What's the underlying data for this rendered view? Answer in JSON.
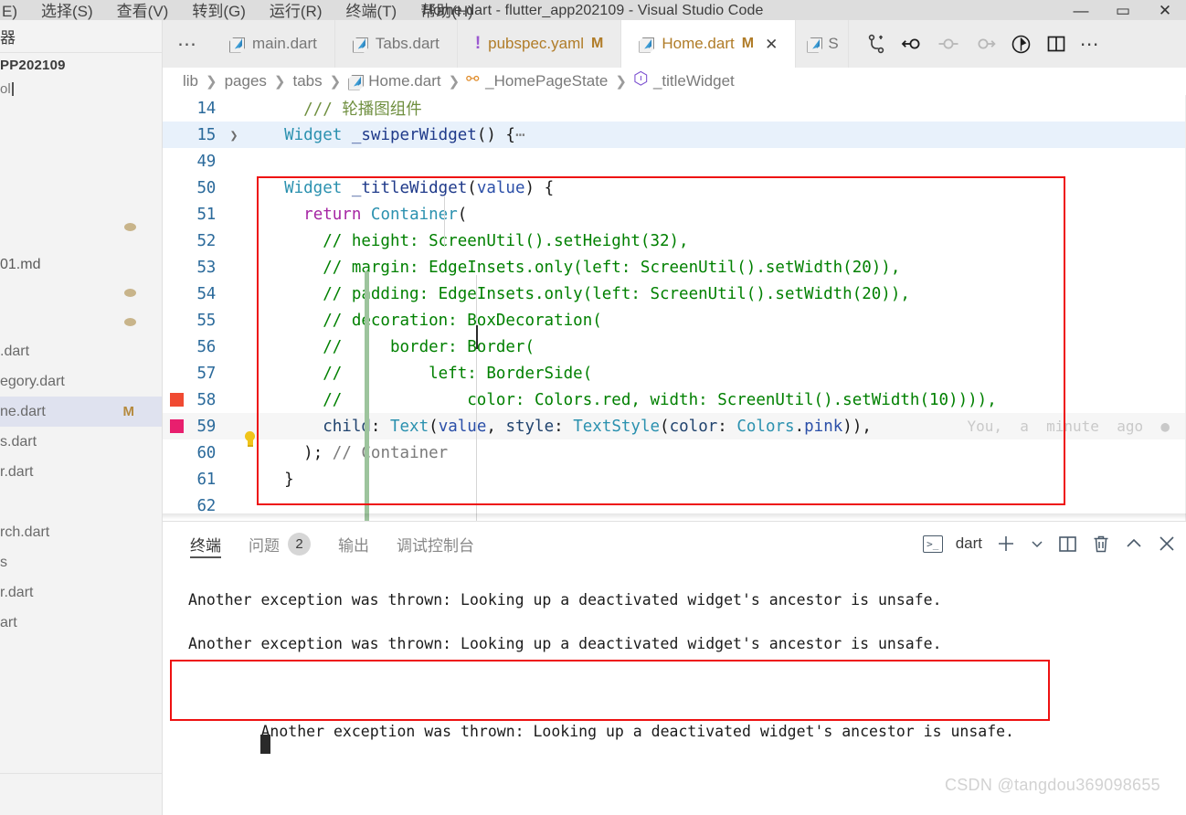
{
  "window": {
    "title": "Home.dart - flutter_app202109 - Visual Studio Code",
    "menu": [
      "E)",
      "选择(S)",
      "查看(V)",
      "转到(G)",
      "运行(R)",
      "终端(T)",
      "帮助(H)"
    ],
    "controls": {
      "minimize": "—",
      "maximize": "▭",
      "close": "✕"
    }
  },
  "sidebar": {
    "title_clipped": "器",
    "folder_clipped": "PP202109",
    "search_clipped": "ol",
    "items": [
      {
        "label": "01.md",
        "kind": "file",
        "badge": "",
        "dot": false
      },
      {
        "label": ".dart",
        "kind": "dart",
        "badge": "",
        "dot": false
      },
      {
        "label": "egory.dart",
        "kind": "dart",
        "badge": "",
        "dot": false
      },
      {
        "label": "ne.dart",
        "kind": "dart",
        "badge": "M",
        "dot": false,
        "selected": true
      },
      {
        "label": "s.dart",
        "kind": "dart",
        "badge": "",
        "dot": false
      },
      {
        "label": "r.dart",
        "kind": "dart",
        "badge": "",
        "dot": false
      },
      {
        "label": "rch.dart",
        "kind": "dart",
        "badge": "",
        "dot": false
      },
      {
        "label": "s",
        "kind": "folder",
        "badge": "",
        "dot": false
      },
      {
        "label": "r.dart",
        "kind": "dart",
        "badge": "",
        "dot": false
      },
      {
        "label": "art",
        "kind": "dart",
        "badge": "",
        "dot": false
      }
    ]
  },
  "tabs": [
    {
      "label": "main.dart",
      "icon": "dart-icon",
      "modified": "",
      "active": false
    },
    {
      "label": "Tabs.dart",
      "icon": "dart-icon",
      "modified": "",
      "active": false
    },
    {
      "label": "pubspec.yaml",
      "icon": "warning-icon",
      "modified": "M",
      "active": false
    },
    {
      "label": "Home.dart",
      "icon": "dart-icon",
      "modified": "M",
      "active": true
    }
  ],
  "tab_overflow_clipped": "S",
  "tab_more_ellipsis": "⋯",
  "breadcrumb": [
    {
      "label": "lib",
      "icon": ""
    },
    {
      "label": "pages",
      "icon": ""
    },
    {
      "label": "tabs",
      "icon": ""
    },
    {
      "label": "Home.dart",
      "icon": "dart-icon"
    },
    {
      "label": "_HomePageState",
      "icon": "class-icon"
    },
    {
      "label": "_titleWidget",
      "icon": "method-cube-icon"
    }
  ],
  "editor": {
    "codelens": "You,  a  minute  ago",
    "lines": [
      {
        "num": "14",
        "folded": false,
        "highlight": false,
        "tokens": [
          {
            "t": "/// ",
            "c": "t-doc"
          },
          {
            "t": "轮播图组件",
            "c": "t-doc"
          }
        ],
        "indent": "    "
      },
      {
        "num": "15",
        "folded": true,
        "highlight": true,
        "tokens": [
          {
            "t": "Widget",
            "c": "t-type"
          },
          {
            "t": " ",
            "c": "t-plain"
          },
          {
            "t": "_swiperWidget",
            "c": "t-fn"
          },
          {
            "t": "() {",
            "c": "t-plain"
          },
          {
            "t": "⋯",
            "c": "t-gray"
          }
        ],
        "indent": "  "
      },
      {
        "num": "49",
        "folded": false,
        "highlight": false,
        "tokens": [],
        "indent": ""
      },
      {
        "num": "50",
        "folded": false,
        "highlight": false,
        "tokens": [
          {
            "t": "Widget",
            "c": "t-type"
          },
          {
            "t": " ",
            "c": "t-plain"
          },
          {
            "t": "_titleWidget",
            "c": "t-fn"
          },
          {
            "t": "(",
            "c": "t-plain"
          },
          {
            "t": "value",
            "c": "t-param"
          },
          {
            "t": ") {",
            "c": "t-plain"
          }
        ],
        "indent": "  "
      },
      {
        "num": "51",
        "folded": false,
        "highlight": false,
        "tokens": [
          {
            "t": "return",
            "c": "t-kw"
          },
          {
            "t": " ",
            "c": "t-plain"
          },
          {
            "t": "Container",
            "c": "t-cls"
          },
          {
            "t": "(",
            "c": "t-plain"
          }
        ],
        "indent": "    "
      },
      {
        "num": "52",
        "folded": false,
        "highlight": false,
        "tokens": [
          {
            "t": "// height: ScreenUtil().setHeight(32),",
            "c": "t-comment"
          }
        ],
        "indent": "      "
      },
      {
        "num": "53",
        "folded": false,
        "highlight": false,
        "tokens": [
          {
            "t": "// margin: EdgeInsets.only(left: ScreenUtil().setWidth(20)),",
            "c": "t-comment"
          }
        ],
        "indent": "      "
      },
      {
        "num": "54",
        "folded": false,
        "highlight": false,
        "tokens": [
          {
            "t": "// padding: EdgeInsets.only(left: ScreenUtil().setWidth(20)),",
            "c": "t-comment"
          }
        ],
        "indent": "      "
      },
      {
        "num": "55",
        "folded": false,
        "highlight": false,
        "tokens": [
          {
            "t": "// decoration: BoxDecoration(",
            "c": "t-comment"
          }
        ],
        "indent": "      "
      },
      {
        "num": "56",
        "folded": false,
        "highlight": false,
        "tokens": [
          {
            "t": "//     border: Border(",
            "c": "t-comment"
          }
        ],
        "indent": "      "
      },
      {
        "num": "57",
        "folded": false,
        "highlight": false,
        "tokens": [
          {
            "t": "//         left: BorderSide(",
            "c": "t-comment"
          }
        ],
        "indent": "      "
      },
      {
        "num": "58",
        "folded": false,
        "highlight": false,
        "breakpoint": "red",
        "tokens": [
          {
            "t": "//             color: Colors.red, width: ScreenUtil().setWidth(10)))),",
            "c": "t-comment"
          }
        ],
        "indent": "      "
      },
      {
        "num": "59",
        "folded": false,
        "highlight": false,
        "breakpoint": "pink",
        "bulb": true,
        "current": true,
        "tokens": [
          {
            "t": "child",
            "c": "t-prop"
          },
          {
            "t": ": ",
            "c": "t-plain"
          },
          {
            "t": "Text",
            "c": "t-cls"
          },
          {
            "t": "(",
            "c": "t-plain"
          },
          {
            "t": "value",
            "c": "t-param"
          },
          {
            "t": ", ",
            "c": "t-plain"
          },
          {
            "t": "style",
            "c": "t-prop"
          },
          {
            "t": ": ",
            "c": "t-plain"
          },
          {
            "t": "TextStyle",
            "c": "t-cls"
          },
          {
            "t": "(",
            "c": "t-plain"
          },
          {
            "t": "color",
            "c": "t-prop"
          },
          {
            "t": ": ",
            "c": "t-plain"
          },
          {
            "t": "Colors",
            "c": "t-cls"
          },
          {
            "t": ".",
            "c": "t-plain"
          },
          {
            "t": "pink",
            "c": "t-param"
          },
          {
            "t": ")),",
            "c": "t-plain"
          }
        ],
        "indent": "      "
      },
      {
        "num": "60",
        "folded": false,
        "highlight": false,
        "tokens": [
          {
            "t": ")",
            "c": "t-plain"
          },
          {
            "t": "; ",
            "c": "t-plain"
          },
          {
            "t": "// Container",
            "c": "t-gray"
          }
        ],
        "indent": "    "
      },
      {
        "num": "61",
        "folded": false,
        "highlight": false,
        "tokens": [
          {
            "t": "}",
            "c": "t-plain"
          }
        ],
        "indent": "  "
      },
      {
        "num": "62",
        "folded": false,
        "highlight": false,
        "tokens": [],
        "indent": ""
      }
    ]
  },
  "panel": {
    "tabs": [
      {
        "label": "终端",
        "badge": "",
        "active": true
      },
      {
        "label": "问题",
        "badge": "2",
        "active": false
      },
      {
        "label": "输出",
        "badge": "",
        "active": false
      },
      {
        "label": "调试控制台",
        "badge": "",
        "active": false
      }
    ],
    "terminal_name": "dart",
    "tools": [
      "terminal-icon",
      "add-icon",
      "chevron-down-icon",
      "split-icon",
      "trash-icon",
      "collapse-icon",
      "close-icon"
    ],
    "output": [
      "Another exception was thrown: Looking up a deactivated widget's ancestor is unsafe.",
      "Another exception was thrown: Looking up a deactivated widget's ancestor is unsafe.",
      "Another exception was thrown: Looking up a deactivated widget's ancestor is unsafe."
    ]
  },
  "watermark": "CSDN @tangdou369098655",
  "colors": {
    "annotation_red": "#ee1111",
    "tab_modified": "#b07c28",
    "breakpoint_red": "#f04a32",
    "breakpoint_pink": "#e81f6e",
    "fold_strip_green": "#9dc49d",
    "line_number": "#2b6a9b",
    "comment_green": "#008000"
  }
}
